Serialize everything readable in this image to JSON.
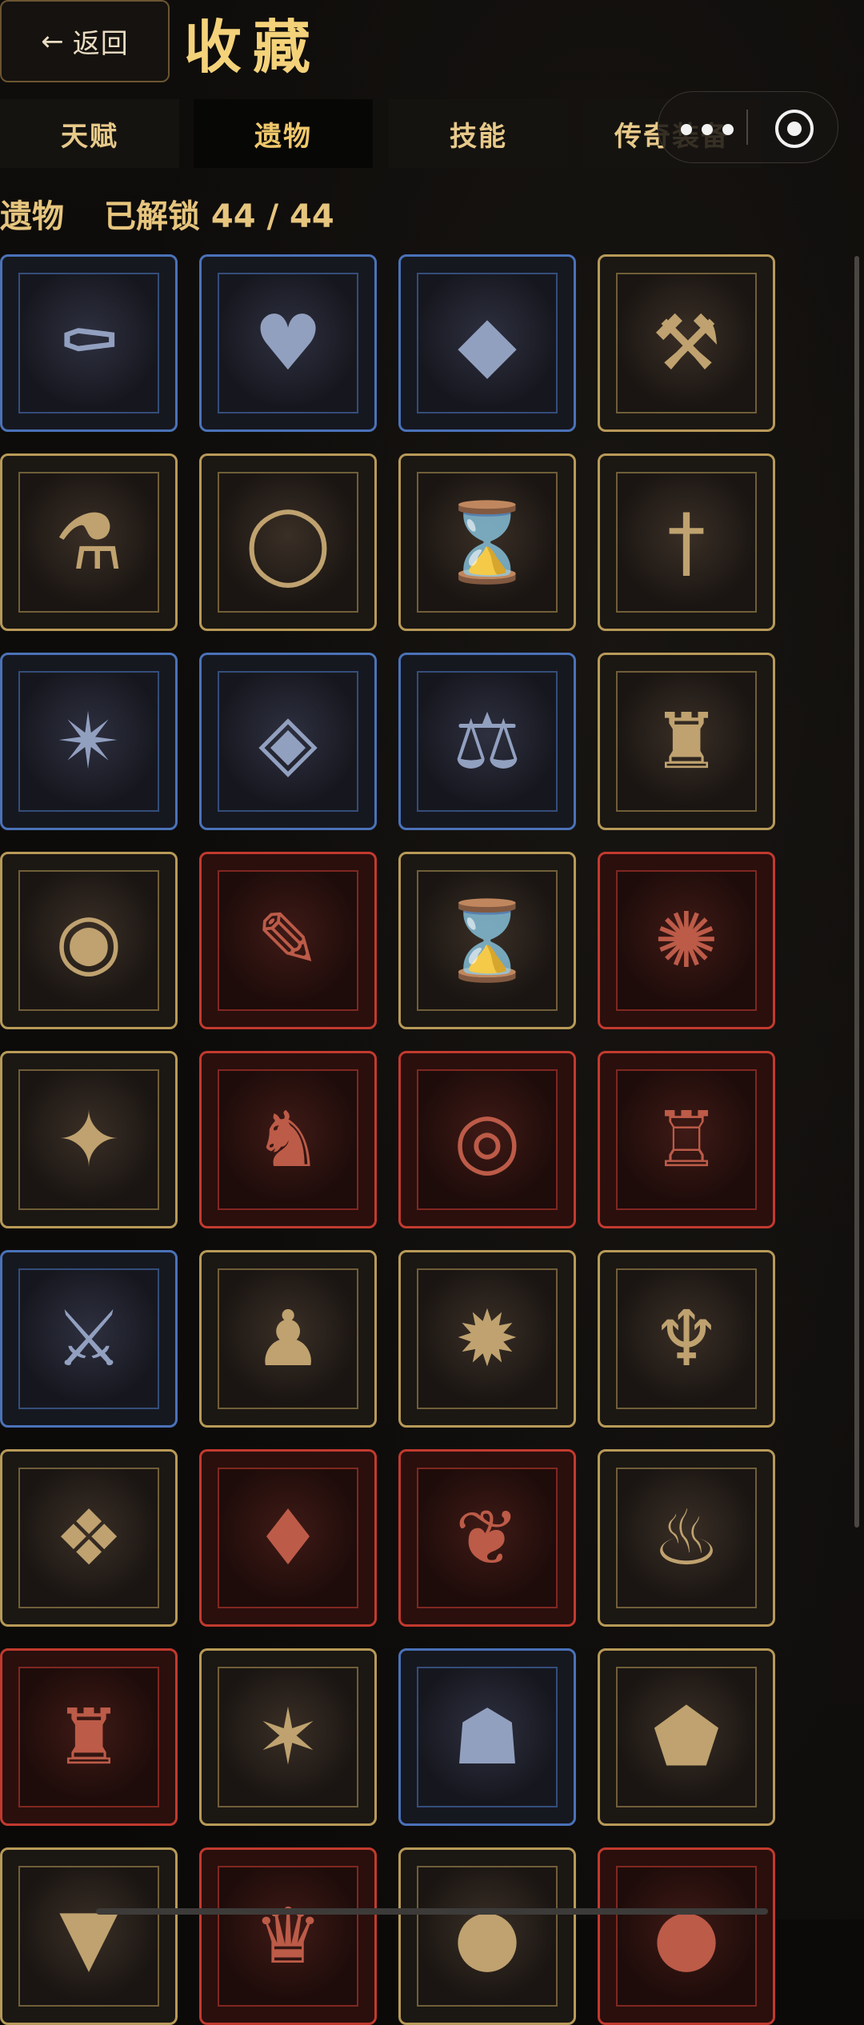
{
  "header": {
    "back_arrow": "←",
    "back_label": "返回",
    "title": "收藏"
  },
  "tabs": [
    {
      "label": "天赋",
      "active": false
    },
    {
      "label": "遗物",
      "active": true
    },
    {
      "label": "技能",
      "active": false
    },
    {
      "label": "传奇装备",
      "active": false
    }
  ],
  "capsule": {
    "more_icon": "more-dots-icon",
    "close_icon": "target-close-icon"
  },
  "section": {
    "name": "遗物",
    "unlocked_text": "已解锁 44 / 44"
  },
  "relics": [
    {
      "icon": "coffin-icon",
      "glyph": "⚰",
      "rarity": "blue"
    },
    {
      "icon": "chained-heart-icon",
      "glyph": "♥",
      "rarity": "blue"
    },
    {
      "icon": "purple-crystal-icon",
      "glyph": "◆",
      "rarity": "blue"
    },
    {
      "icon": "flaming-anvil-icon",
      "glyph": "⚒",
      "rarity": "gold"
    },
    {
      "icon": "blood-jar-icon",
      "glyph": "⚗",
      "rarity": "gold"
    },
    {
      "icon": "spiked-ring-icon",
      "glyph": "◯",
      "rarity": "gold"
    },
    {
      "icon": "hourglass-lantern-icon",
      "glyph": "⌛",
      "rarity": "gold"
    },
    {
      "icon": "dagger-block-icon",
      "glyph": "†",
      "rarity": "gold"
    },
    {
      "icon": "compass-star-icon",
      "glyph": "✴",
      "rarity": "blue"
    },
    {
      "icon": "green-gem-icon",
      "glyph": "◈",
      "rarity": "blue"
    },
    {
      "icon": "scales-icon",
      "glyph": "⚖",
      "rarity": "blue"
    },
    {
      "icon": "coin-purse-icon",
      "glyph": "♜",
      "rarity": "gold"
    },
    {
      "icon": "eye-crystal-icon",
      "glyph": "◉",
      "rarity": "gold"
    },
    {
      "icon": "fire-feather-icon",
      "glyph": "✎",
      "rarity": "red"
    },
    {
      "icon": "chained-hourglass-icon",
      "glyph": "⌛",
      "rarity": "gold"
    },
    {
      "icon": "lightning-orb-icon",
      "glyph": "✺",
      "rarity": "red"
    },
    {
      "icon": "lightning-shuriken-icon",
      "glyph": "✦",
      "rarity": "gold"
    },
    {
      "icon": "eagle-head-icon",
      "glyph": "♞",
      "rarity": "red"
    },
    {
      "icon": "red-seal-icon",
      "glyph": "◎",
      "rarity": "red"
    },
    {
      "icon": "dark-lantern-icon",
      "glyph": "♖",
      "rarity": "red"
    },
    {
      "icon": "crossed-swords-icon",
      "glyph": "⚔",
      "rarity": "blue"
    },
    {
      "icon": "winged-boot-icon",
      "glyph": "♟",
      "rarity": "gold"
    },
    {
      "icon": "thorn-wheel-icon",
      "glyph": "✹",
      "rarity": "gold"
    },
    {
      "icon": "bat-amulet-icon",
      "glyph": "♆",
      "rarity": "gold"
    },
    {
      "icon": "rune-tablet-icon",
      "glyph": "❖",
      "rarity": "gold"
    },
    {
      "icon": "clawed-crystal-icon",
      "glyph": "♦",
      "rarity": "red"
    },
    {
      "icon": "ruby-necklace-icon",
      "glyph": "❦",
      "rarity": "red"
    },
    {
      "icon": "flaming-gold-icon",
      "glyph": "♨",
      "rarity": "gold"
    },
    {
      "icon": "fortress-icon",
      "glyph": "♜",
      "rarity": "red"
    },
    {
      "icon": "star-pendant-icon",
      "glyph": "✶",
      "rarity": "gold"
    },
    {
      "icon": "treasure-bag-icon",
      "glyph": "☗",
      "rarity": "blue"
    },
    {
      "icon": "shield-crystal-icon",
      "glyph": "⬟",
      "rarity": "gold"
    },
    {
      "icon": "fanged-maw-icon",
      "glyph": "▼",
      "rarity": "gold"
    },
    {
      "icon": "crown-icon",
      "glyph": "♛",
      "rarity": "red"
    },
    {
      "icon": "dark-relic-icon",
      "glyph": "●",
      "rarity": "gold"
    },
    {
      "icon": "blood-relic-icon",
      "glyph": "●",
      "rarity": "red"
    }
  ]
}
